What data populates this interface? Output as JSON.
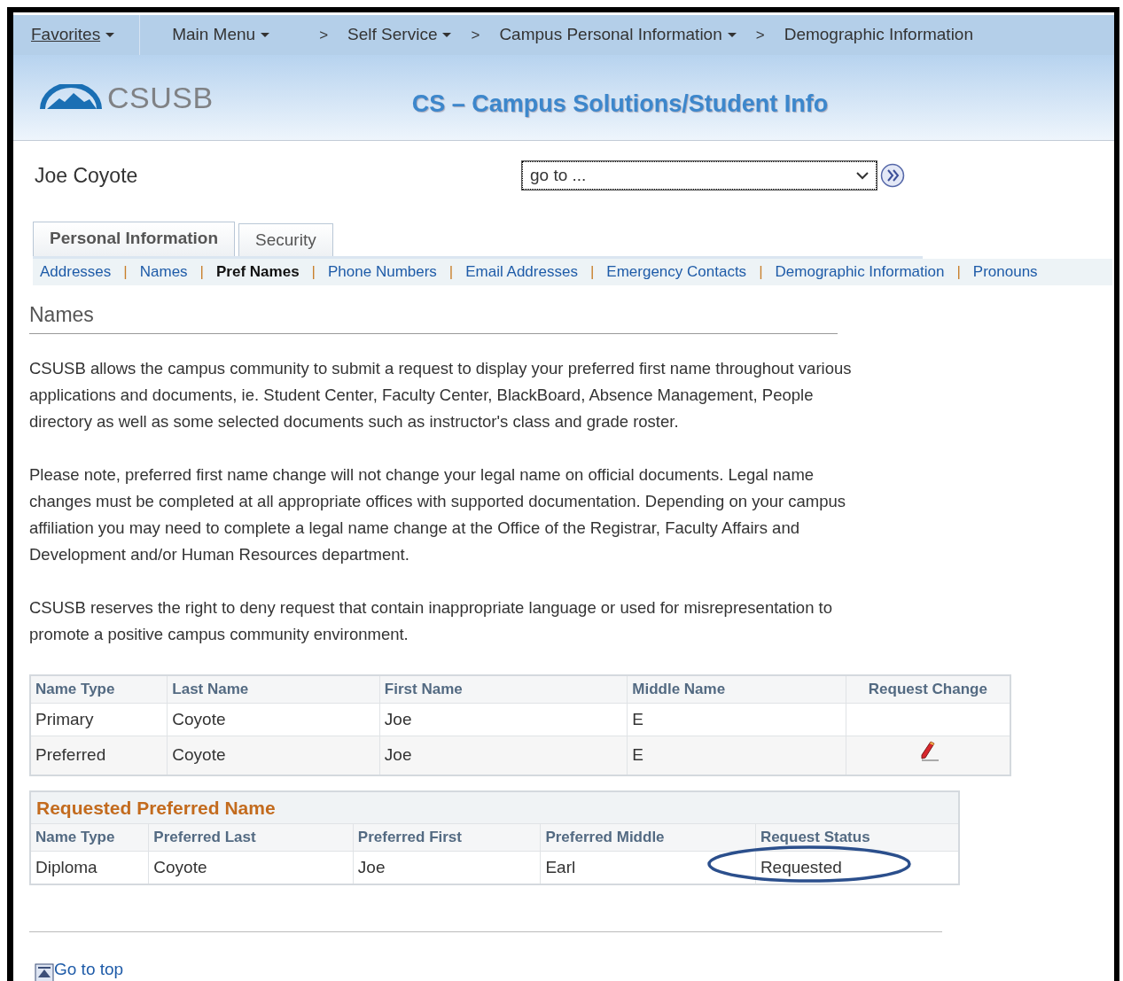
{
  "breadcrumbs": [
    {
      "label": "Favorites",
      "has_menu": true,
      "underlined": true
    },
    {
      "label": "Main Menu",
      "has_menu": true,
      "underlined": false
    },
    {
      "label": "Self Service",
      "has_menu": true,
      "underlined": false,
      "separator": ">"
    },
    {
      "label": "Campus Personal Information",
      "has_menu": true,
      "underlined": false,
      "separator": ">"
    },
    {
      "label": "Demographic Information",
      "has_menu": false,
      "underlined": false,
      "separator": ">"
    }
  ],
  "header": {
    "logo_text": "CSUSB",
    "title": "CS – Campus Solutions/Student Info"
  },
  "user_name": "Joe Coyote",
  "goto_select": {
    "value": "go to ..."
  },
  "tabs": [
    {
      "label": "Personal Information",
      "selected": true
    },
    {
      "label": "Security",
      "selected": false
    }
  ],
  "subnav": [
    {
      "label": "Addresses",
      "selected": false
    },
    {
      "label": "Names",
      "selected": false
    },
    {
      "label": "Pref Names",
      "selected": true
    },
    {
      "label": "Phone Numbers",
      "selected": false
    },
    {
      "label": "Email Addresses",
      "selected": false
    },
    {
      "label": "Emergency Contacts",
      "selected": false
    },
    {
      "label": "Demographic Information",
      "selected": false
    },
    {
      "label": "Pronouns",
      "selected": false
    }
  ],
  "subnav_separator": "|",
  "section_title": "Names",
  "paragraphs": [
    "CSUSB allows the campus community to submit a request to display your preferred first name throughout various applications and documents, ie. Student Center, Faculty Center, BlackBoard, Absence Management, People directory as well as some selected documents such as instructor's class and grade roster.",
    "Please note, preferred first name change will not change your legal name on official documents. Legal name changes must be completed at all appropriate offices with supported documentation. Depending on your campus affiliation you may need to complete a legal name change at the Office of the Registrar, Faculty Affairs and Development and/or Human Resources department.",
    "CSUSB reserves the right to deny request that contain inappropriate language or used for misrepresentation to promote a positive campus community environment."
  ],
  "names_table": {
    "columns": [
      "Name Type",
      "Last Name",
      "First Name",
      "Middle Name",
      "Request Change"
    ],
    "rows": [
      {
        "cells": [
          "Primary",
          "Coyote",
          "Joe",
          "E"
        ],
        "editable": false
      },
      {
        "cells": [
          "Preferred",
          "Coyote",
          "Joe",
          "E"
        ],
        "editable": true
      }
    ]
  },
  "requested_table": {
    "title": "Requested Preferred Name",
    "columns": [
      "Name Type",
      "Preferred Last",
      "Preferred First",
      "Preferred Middle",
      "Request Status"
    ],
    "rows": [
      {
        "cells": [
          "Diploma",
          "Coyote",
          "Joe",
          "Earl",
          "Requested"
        ],
        "circled": true
      }
    ]
  },
  "go_to_top": "Go to top"
}
